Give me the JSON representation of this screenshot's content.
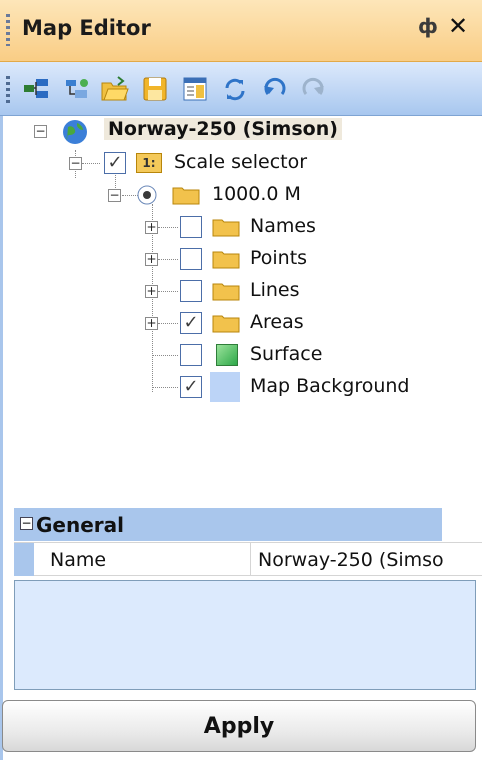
{
  "window": {
    "title": "Map Editor",
    "pin_glyph": "ф",
    "close_glyph": "✕"
  },
  "toolbar": {
    "buttons": [
      {
        "icon": "add-layer-icon"
      },
      {
        "icon": "add-group-icon"
      },
      {
        "icon": "open-folder-icon"
      },
      {
        "icon": "save-icon"
      },
      {
        "icon": "properties-icon"
      },
      {
        "icon": "refresh-icon"
      },
      {
        "icon": "undo-icon"
      },
      {
        "icon": "redo-icon"
      }
    ]
  },
  "tree": {
    "root": {
      "label": "Norway-250 (Simson)",
      "expander": "−"
    },
    "scale_selector": {
      "label": "Scale selector",
      "badge": "1:",
      "checked": true,
      "expander": "−"
    },
    "scale": {
      "label": "1000.0 M",
      "expander": "−"
    },
    "layers": [
      {
        "label": "Names",
        "checked": false,
        "expander": "+",
        "icon": "folder"
      },
      {
        "label": "Points",
        "checked": false,
        "expander": "+",
        "icon": "folder"
      },
      {
        "label": "Lines",
        "checked": false,
        "expander": "+",
        "icon": "folder"
      },
      {
        "label": "Areas",
        "checked": true,
        "expander": "+",
        "icon": "folder"
      },
      {
        "label": "Surface",
        "checked": false,
        "expander": "",
        "icon": "surface"
      },
      {
        "label": "Map Background",
        "checked": true,
        "expander": "",
        "icon": "background"
      }
    ],
    "check_glyph": "✓"
  },
  "properties": {
    "section": "General",
    "section_toggle": "−",
    "rows": [
      {
        "name": "Name",
        "value": "Norway-250 (Simso"
      }
    ]
  },
  "apply_label": "Apply",
  "colors": {
    "title_bg": "#f9cd85",
    "toolbar_bg": "#a8c7ef",
    "selection": "#a9c6ec",
    "desc_bg": "#dceafd"
  }
}
